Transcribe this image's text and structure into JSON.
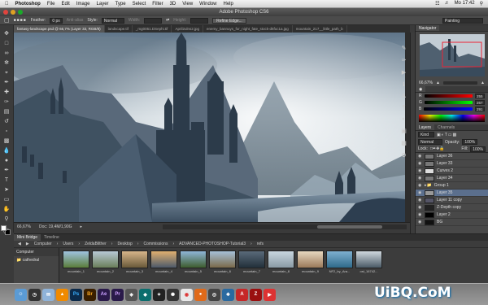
{
  "menubar": {
    "apple": "",
    "app": "Photoshop",
    "items": [
      "File",
      "Edit",
      "Image",
      "Layer",
      "Type",
      "Select",
      "Filter",
      "3D",
      "View",
      "Window",
      "Help"
    ],
    "clock": "Mo 17:42"
  },
  "window_title": "Adobe Photoshop CS6",
  "options": {
    "feather_label": "Feather:",
    "feather_value": "0 px",
    "antialias": "Anti-alias",
    "style_label": "Style:",
    "style_value": "Normal",
    "width_label": "Width:",
    "height_label": "Height:",
    "refine_edge": "Refine Edge...",
    "workspace": "Painting"
  },
  "doc_tabs": [
    {
      "label": "fantasy-landscape.psd @ 66,7% (Layer 33, RGB/8)",
      "active": true
    },
    {
      "label": "landscape.tif",
      "active": false
    },
    {
      "label": "_mg0051.DSephi.tif",
      "active": false
    },
    {
      "label": "April2ulns2.jpg",
      "active": false
    },
    {
      "label": "enemy_bannuys_for_night_fate_stock-d6fuc1a.jpg",
      "active": false
    },
    {
      "label": "mountain_217__little_path_b",
      "active": false
    }
  ],
  "status": {
    "zoom": "66,67%",
    "doc": "Doc: 19,4M/1,90G"
  },
  "navigator": {
    "tabs": [
      "Navigator"
    ],
    "zoom": "66,67%"
  },
  "color": {
    "r": "255",
    "g": "267",
    "b": "291"
  },
  "layers": {
    "tabs": [
      "Layers",
      "Channels"
    ],
    "kind": "Kind",
    "blend": "Normal",
    "opacity_label": "Opacity:",
    "opacity": "100%",
    "lock_label": "Lock:",
    "fill_label": "Fill:",
    "fill": "100%",
    "rows": [
      {
        "name": "Layer 36",
        "sel": false
      },
      {
        "name": "Layer 33",
        "sel": false
      },
      {
        "name": "Curves 2",
        "sel": false
      },
      {
        "name": "Layer 34",
        "sel": false
      },
      {
        "name": "Group 1",
        "sel": false
      },
      {
        "name": "Layer 35",
        "sel": true
      },
      {
        "name": "Layer 11 copy",
        "sel": false
      },
      {
        "name": "Z-Depth copy",
        "sel": false
      },
      {
        "name": "Layer 2",
        "sel": false
      },
      {
        "name": "BG",
        "sel": false
      }
    ]
  },
  "minibridge": {
    "tabs": [
      "Mini Bridge",
      "Timeline"
    ],
    "path": [
      "Computer",
      "Users",
      "ZeldaBilther",
      "Desktop",
      "Commissions",
      "ADVANCED-PHOTOSHOP-Tutorial3",
      "refs"
    ],
    "side_title": "Computer",
    "side_item": "cathedral",
    "thumbs": [
      "mountain_1",
      "mountain_2",
      "mountain_3",
      "mountain_4",
      "mountain_5",
      "mountain_6",
      "mountain_7",
      "mountain_8",
      "mountain_9",
      "NF2_by_Ara...",
      "ost_16742..."
    ]
  },
  "dock": [
    "Finder",
    "Dashboard",
    "Mail",
    "VLC",
    "Photoshop",
    "Bridge",
    "After Effects",
    "Premiere",
    "Unity",
    "Acrobat",
    "Chrome",
    "Firefox",
    "Terminal",
    "Preview"
  ],
  "watermark": "UiBQ.CoM"
}
